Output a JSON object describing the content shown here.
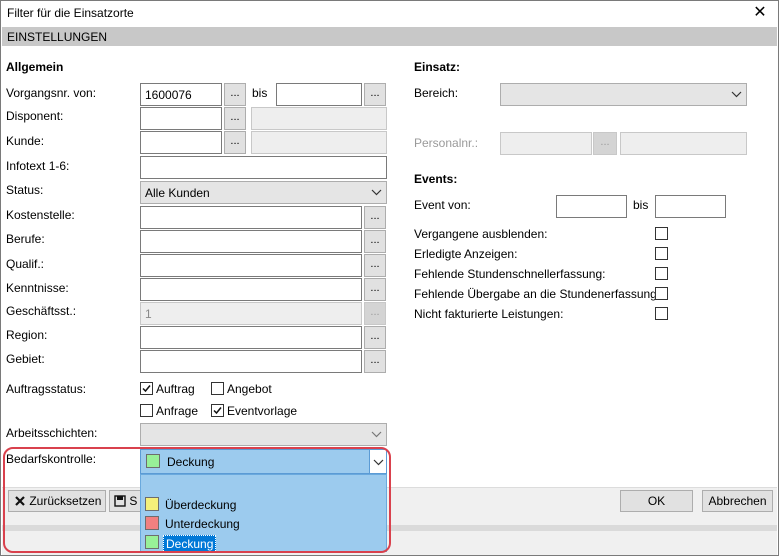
{
  "window": {
    "title": "Filter für die Einsatzorte",
    "close_glyph": "✕"
  },
  "section": {
    "title": "EINSTELLUNGEN"
  },
  "allgemein": {
    "heading": "Allgemein",
    "vorgangsnr_label": "Vorgangsnr. von:",
    "vorgangsnr_from": "1600076",
    "bis_label": "bis",
    "vorgangsnr_to": "",
    "disponent_label": "Disponent:",
    "kunde_label": "Kunde:",
    "infotext_label": "Infotext 1-6:",
    "status_label": "Status:",
    "status_value": "Alle Kunden",
    "kostenstelle_label": "Kostenstelle:",
    "berufe_label": "Berufe:",
    "qualif_label": "Qualif.:",
    "kenntnisse_label": "Kenntnisse:",
    "geschaeftsst_label": "Geschäftsst.:",
    "geschaeftsst_value": "1",
    "region_label": "Region:",
    "gebiet_label": "Gebiet:",
    "auftragsstatus_label": "Auftragsstatus:",
    "auftrag_label": "Auftrag",
    "angebot_label": "Angebot",
    "anfrage_label": "Anfrage",
    "eventvorlage_label": "Eventvorlage",
    "arbeitsschichten_label": "Arbeitsschichten:",
    "bedarfskontrolle_label": "Bedarfskontrolle:",
    "bedarfskontrolle_value": "Deckung",
    "dots": "..."
  },
  "checks": {
    "auftrag": true,
    "angebot": false,
    "anfrage": false,
    "eventvorlage": true
  },
  "einsatz": {
    "heading": "Einsatz:",
    "bereich_label": "Bereich:",
    "personalnr_label": "Personalnr.:"
  },
  "events": {
    "heading": "Events:",
    "event_von_label": "Event von:",
    "bis_label": "bis",
    "vergangene_label": "Vergangene ausblenden:",
    "erledigte_label": "Erledigte Anzeigen:",
    "fehlende_stunden_label": "Fehlende Stundenschnellerfassung:",
    "fehlende_uebergabe_label": "Fehlende Übergabe an die Stundenerfassung:",
    "nicht_fakturierte_label": "Nicht fakturierte Leistungen:"
  },
  "dropdown": {
    "options": [
      {
        "label": "Überdeckung",
        "color": "#f5f07a"
      },
      {
        "label": "Unterdeckung",
        "color": "#f08080"
      },
      {
        "label": "Deckung",
        "color": "#98f098"
      }
    ],
    "selected_index": 2
  },
  "buttons": {
    "zuruecksetzen": "Zurücksetzen",
    "partial": "S",
    "ok": "OK",
    "abbrechen": "Abbrechen"
  },
  "colors": {
    "highlight_ring": "#d9414d",
    "dropdown_bg": "#9ccbee",
    "selection": "#0078d7"
  }
}
